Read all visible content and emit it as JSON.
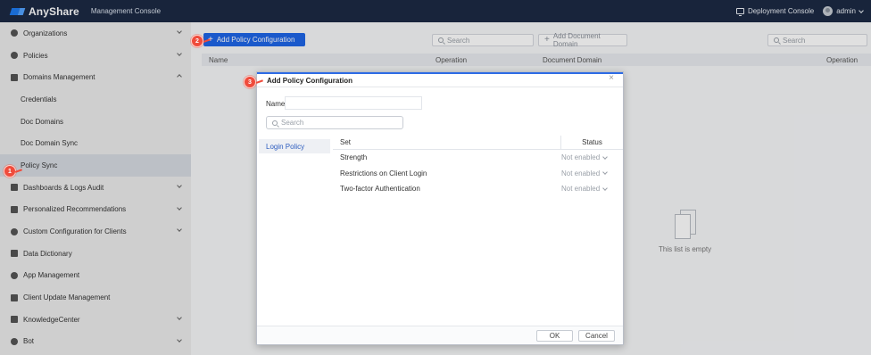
{
  "app": {
    "logo": "AnyShare",
    "console_title": "Management Console",
    "deployment_console": "Deployment Console",
    "user": "admin"
  },
  "sidebar": {
    "items": [
      {
        "label": "Organizations",
        "icon": "organizations-icon"
      },
      {
        "label": "Policies",
        "icon": "policies-icon"
      },
      {
        "label": "Domains Management",
        "icon": "domains-management-icon"
      },
      {
        "label": "Credentials"
      },
      {
        "label": "Doc Domains"
      },
      {
        "label": "Doc Domain Sync"
      },
      {
        "label": "Policy Sync"
      },
      {
        "label": "Dashboards & Logs Audit",
        "icon": "dashboards-icon"
      },
      {
        "label": "Personalized Recommendations",
        "icon": "recommendations-icon"
      },
      {
        "label": "Custom Configuration for Clients",
        "icon": "custom-config-icon"
      },
      {
        "label": "Data Dictionary",
        "icon": "data-dictionary-icon"
      },
      {
        "label": "App Management",
        "icon": "app-management-icon"
      },
      {
        "label": "Client Update Management",
        "icon": "client-update-icon"
      },
      {
        "label": "KnowledgeCenter",
        "icon": "knowledge-center-icon"
      },
      {
        "label": "Bot",
        "icon": "bot-icon"
      }
    ]
  },
  "main": {
    "add_policy_button": "Add Policy Configuration",
    "left_search_placeholder": "Search",
    "add_doc_domain": "Add Document Domain",
    "right_search_placeholder": "Search",
    "left_headers": [
      "Name",
      "Operation"
    ],
    "right_headers": [
      "Document Domain",
      "Operation"
    ],
    "empty_text": "This list is empty"
  },
  "modal": {
    "title": "Add Policy Configuration",
    "name_label": "Name:",
    "name_value": "",
    "search_placeholder": "Search",
    "tab": "Login Policy",
    "headers": {
      "set": "Set",
      "status": "Status"
    },
    "rows": [
      {
        "set": "Strength",
        "status": "Not enabled"
      },
      {
        "set": "Restrictions on Client Login",
        "status": "Not enabled"
      },
      {
        "set": "Two-factor Authentication",
        "status": "Not enabled"
      }
    ],
    "ok": "OK",
    "cancel": "Cancel"
  },
  "annotations": [
    "1",
    "2",
    "3"
  ]
}
